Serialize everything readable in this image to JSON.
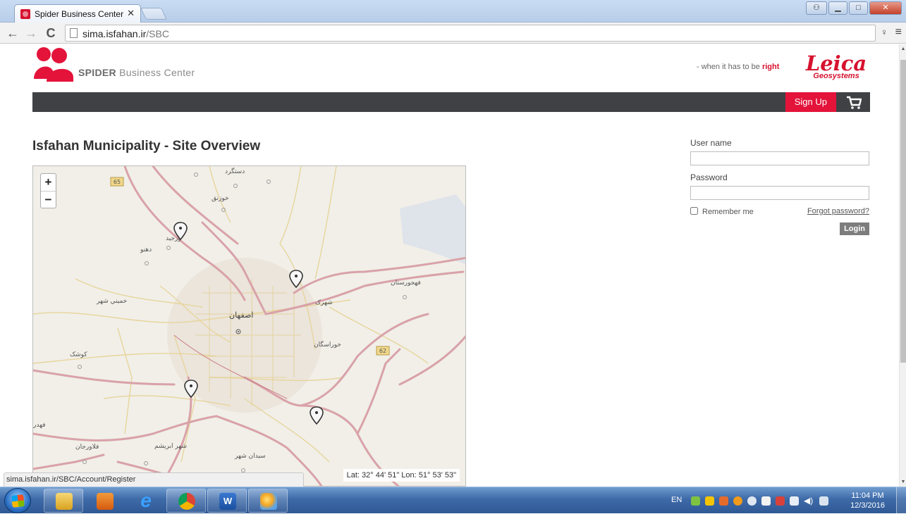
{
  "browser": {
    "tab_title": "Spider Business Center - L",
    "url_host": "sima.isfahan.ir",
    "url_path": "/SBC"
  },
  "header": {
    "brand_bold": "SPIDER",
    "brand_rest": "Business Center",
    "tagline_prefix": "- when it has to be ",
    "tagline_highlight": "right",
    "leica_word": "Leica",
    "leica_sub": "Geosystems"
  },
  "navbar": {
    "signup_label": "Sign Up"
  },
  "main": {
    "page_title": "Isfahan Municipality - Site Overview"
  },
  "map": {
    "zoom_in": "+",
    "zoom_out": "−",
    "coordinates": "Lat: 32° 44' 51\" Lon: 51° 53' 53\"",
    "road_shields": [
      "65",
      "62"
    ],
    "place_labels": [
      "دستگرد",
      "خوزنق",
      "دهنو",
      "ورجيد",
      "فهجورستان",
      "خميني شهر",
      "شهرک",
      "اصفهان",
      "خوراسگان",
      "کوشک",
      "فهدر",
      "فلاورجان",
      "شهر ابريشم",
      "سيدان شهر"
    ]
  },
  "login": {
    "username_label": "User name",
    "password_label": "Password",
    "remember_label": "Remember me",
    "forgot_label": "Forgot password?",
    "login_button": "Login"
  },
  "status_bar": {
    "url": "sima.isfahan.ir/SBC/Account/Register"
  },
  "taskbar": {
    "language": "EN",
    "time": "11:04 PM",
    "date": "12/3/2016"
  },
  "colors": {
    "accent_red": "#e3133a",
    "navbar_dark": "#404145",
    "map_bg": "#f1efe8"
  }
}
